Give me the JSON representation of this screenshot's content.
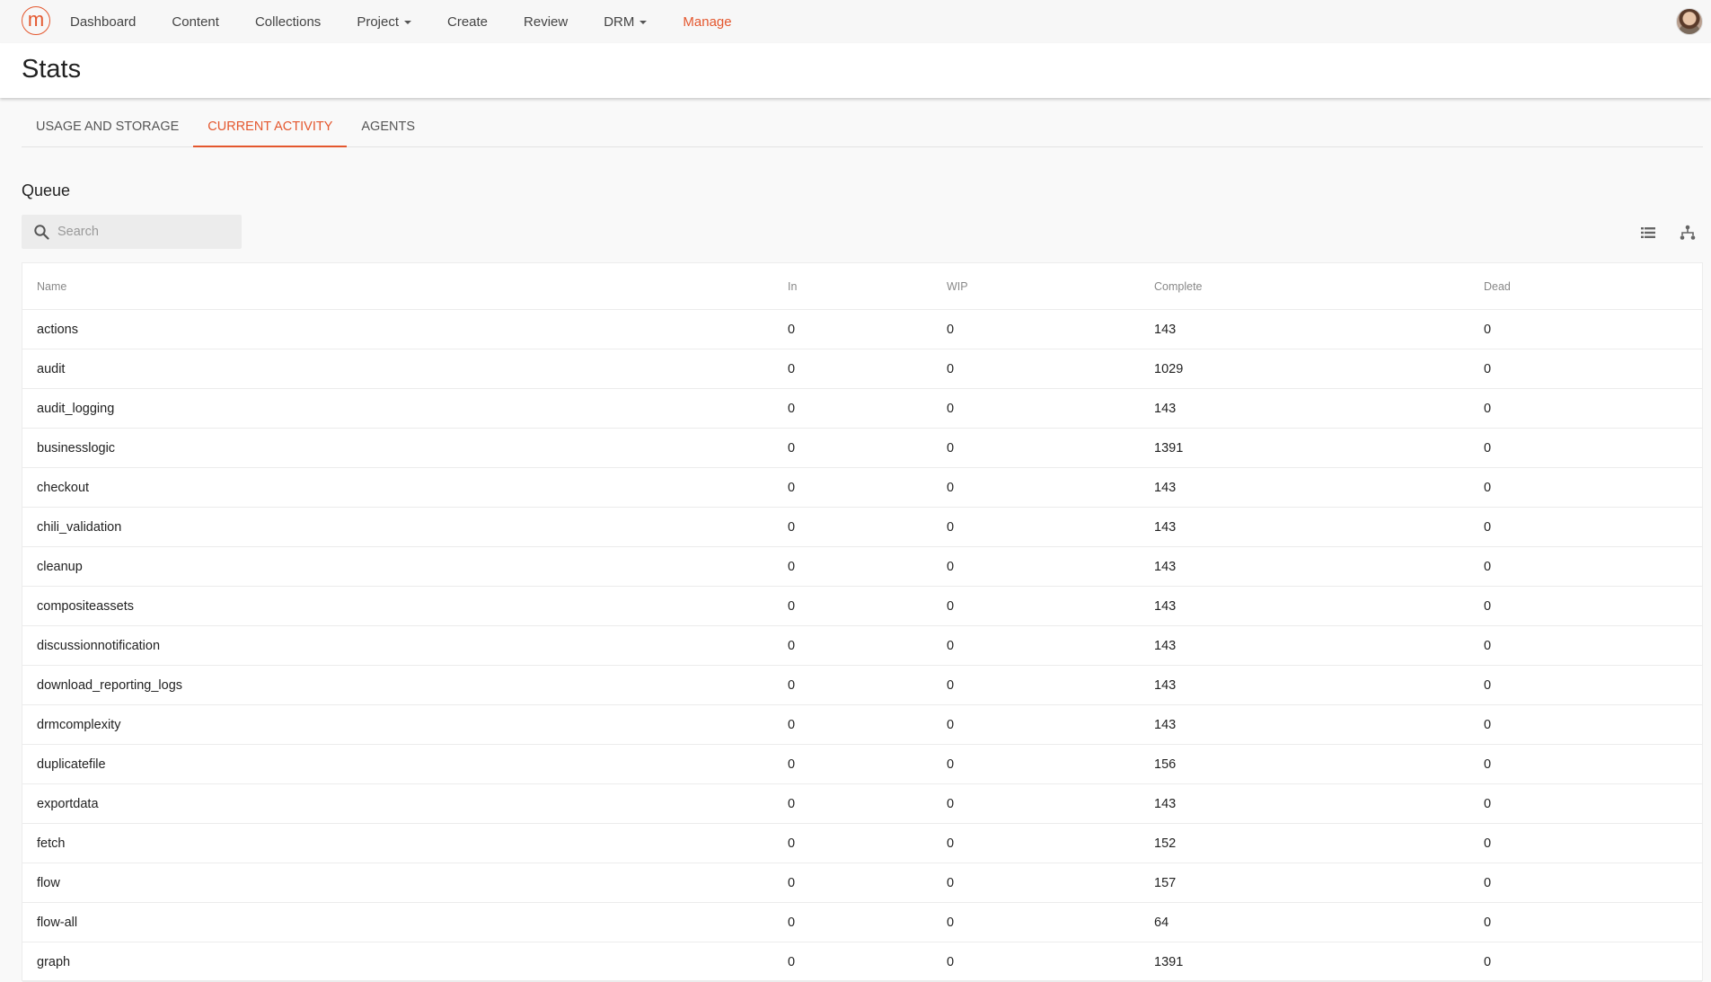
{
  "nav": {
    "logo_letter": "m",
    "items": [
      {
        "label": "Dashboard",
        "dropdown": false,
        "active": false
      },
      {
        "label": "Content",
        "dropdown": false,
        "active": false
      },
      {
        "label": "Collections",
        "dropdown": false,
        "active": false
      },
      {
        "label": "Project",
        "dropdown": true,
        "active": false
      },
      {
        "label": "Create",
        "dropdown": false,
        "active": false
      },
      {
        "label": "Review",
        "dropdown": false,
        "active": false
      },
      {
        "label": "DRM",
        "dropdown": true,
        "active": false
      },
      {
        "label": "Manage",
        "dropdown": false,
        "active": true
      }
    ]
  },
  "page": {
    "title": "Stats"
  },
  "tabs": [
    {
      "label": "USAGE AND STORAGE",
      "active": false
    },
    {
      "label": "CURRENT ACTIVITY",
      "active": true
    },
    {
      "label": "AGENTS",
      "active": false
    }
  ],
  "queue": {
    "title": "Queue",
    "search": {
      "placeholder": "Search",
      "value": ""
    },
    "columns": {
      "name": "Name",
      "in": "In",
      "wip": "WIP",
      "complete": "Complete",
      "dead": "Dead"
    },
    "rows": [
      {
        "name": "actions",
        "in": "0",
        "wip": "0",
        "complete": "143",
        "dead": "0"
      },
      {
        "name": "audit",
        "in": "0",
        "wip": "0",
        "complete": "1029",
        "dead": "0"
      },
      {
        "name": "audit_logging",
        "in": "0",
        "wip": "0",
        "complete": "143",
        "dead": "0"
      },
      {
        "name": "businesslogic",
        "in": "0",
        "wip": "0",
        "complete": "1391",
        "dead": "0"
      },
      {
        "name": "checkout",
        "in": "0",
        "wip": "0",
        "complete": "143",
        "dead": "0"
      },
      {
        "name": "chili_validation",
        "in": "0",
        "wip": "0",
        "complete": "143",
        "dead": "0"
      },
      {
        "name": "cleanup",
        "in": "0",
        "wip": "0",
        "complete": "143",
        "dead": "0"
      },
      {
        "name": "compositeassets",
        "in": "0",
        "wip": "0",
        "complete": "143",
        "dead": "0"
      },
      {
        "name": "discussionnotification",
        "in": "0",
        "wip": "0",
        "complete": "143",
        "dead": "0"
      },
      {
        "name": "download_reporting_logs",
        "in": "0",
        "wip": "0",
        "complete": "143",
        "dead": "0"
      },
      {
        "name": "drmcomplexity",
        "in": "0",
        "wip": "0",
        "complete": "143",
        "dead": "0"
      },
      {
        "name": "duplicatefile",
        "in": "0",
        "wip": "0",
        "complete": "156",
        "dead": "0"
      },
      {
        "name": "exportdata",
        "in": "0",
        "wip": "0",
        "complete": "143",
        "dead": "0"
      },
      {
        "name": "fetch",
        "in": "0",
        "wip": "0",
        "complete": "152",
        "dead": "0"
      },
      {
        "name": "flow",
        "in": "0",
        "wip": "0",
        "complete": "157",
        "dead": "0"
      },
      {
        "name": "flow-all",
        "in": "0",
        "wip": "0",
        "complete": "64",
        "dead": "0"
      },
      {
        "name": "graph",
        "in": "0",
        "wip": "0",
        "complete": "1391",
        "dead": "0"
      }
    ]
  },
  "icons": {
    "search": "search-icon",
    "list_view": "list-view-icon",
    "hierarchy_view": "hierarchy-view-icon",
    "dropdown": "caret-down-icon"
  },
  "colors": {
    "accent": "#e4572e",
    "text": "#222222",
    "muted": "#888888"
  }
}
